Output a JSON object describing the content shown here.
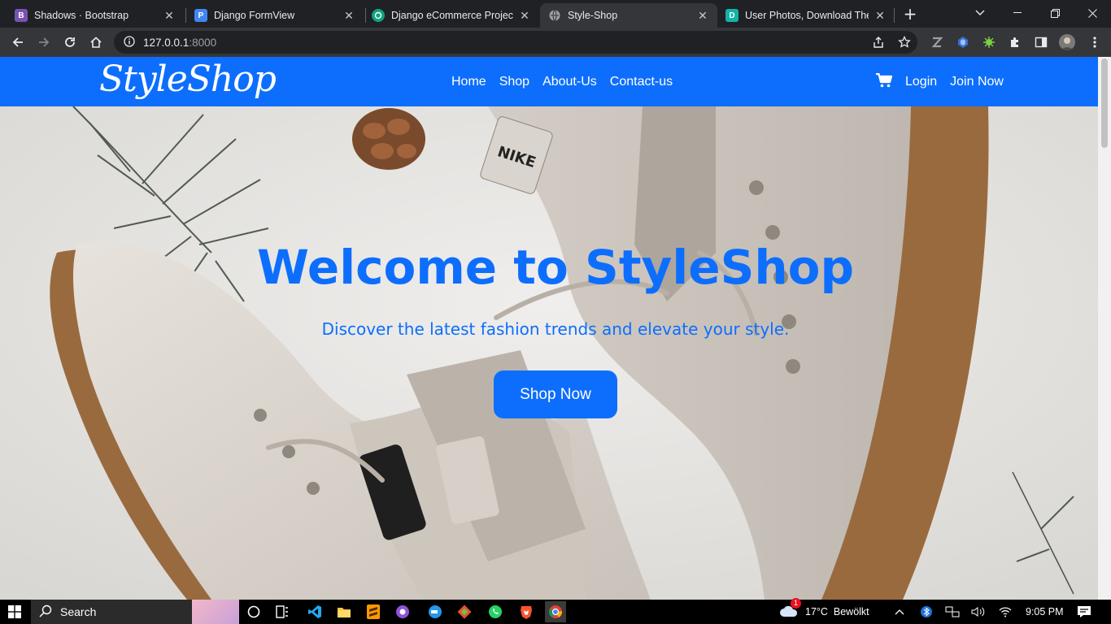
{
  "browser": {
    "tabs": [
      {
        "title": "Shadows · Bootstrap",
        "favicon_letter": "B",
        "favicon_color": "#7952b3"
      },
      {
        "title": "Django FormView",
        "favicon_letter": "P",
        "favicon_color": "#4285f4"
      },
      {
        "title": "Django eCommerce Project",
        "favicon_letter": "",
        "favicon_color": "#10a37f"
      },
      {
        "title": "Style-Shop",
        "favicon_letter": "",
        "favicon_color": "#9aa0a6"
      },
      {
        "title": "User Photos, Download The",
        "favicon_letter": "D",
        "favicon_color": "#12b3a8"
      }
    ],
    "active_tab_index": 3,
    "url_host": "127.0.0.1",
    "url_port": ":8000"
  },
  "site": {
    "brand": "StyleShop",
    "nav_links": [
      "Home",
      "Shop",
      "About-Us",
      "Contact-us"
    ],
    "cart_icon": "cart-icon",
    "login_label": "Login",
    "join_label": "Join Now",
    "primary_color": "#0d6efd"
  },
  "hero": {
    "title": "Welcome to StyleShop",
    "subtitle": "Discover the latest fashion trends and elevate your style.",
    "cta_label": "Shop Now"
  },
  "taskbar": {
    "search_label": "Search",
    "notification_count": "1",
    "weather": "17°C  Bewölkt",
    "time": "9:05 PM"
  }
}
